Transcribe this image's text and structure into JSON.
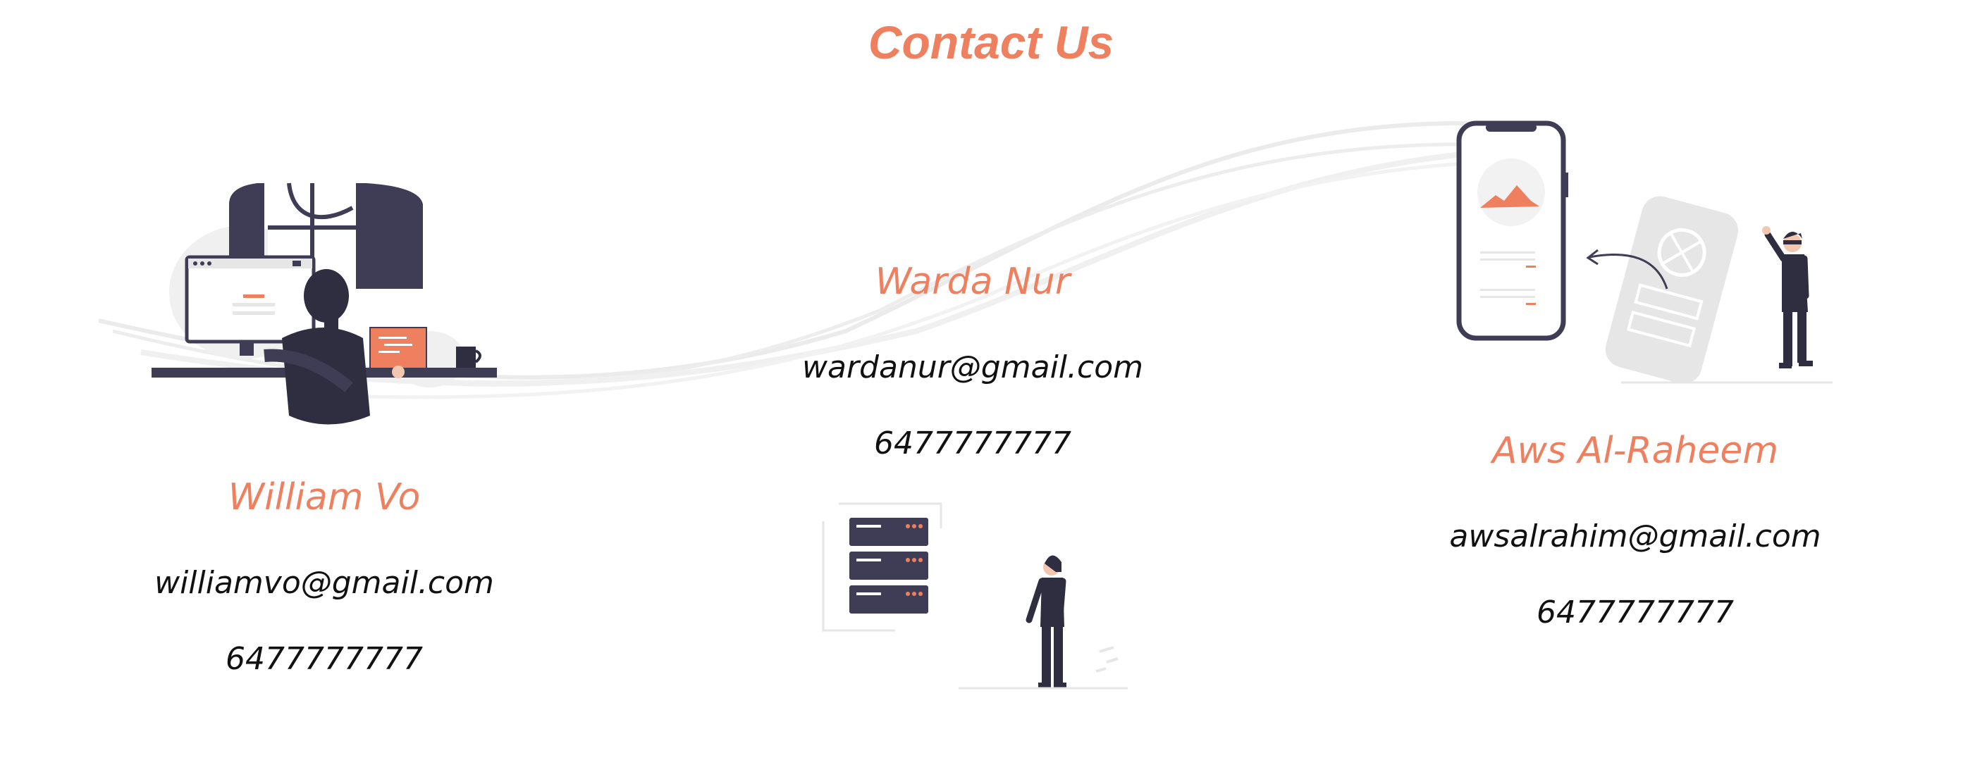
{
  "page": {
    "title": "Contact Us"
  },
  "contacts": [
    {
      "name": "William Vo",
      "email": "williamvo@gmail.com",
      "phone": "6477777777"
    },
    {
      "name": "Warda Nur",
      "email": "wardanur@gmail.com",
      "phone": "6477777777"
    },
    {
      "name": "Aws Al-Raheem",
      "email": "awsalrahim@gmail.com",
      "phone": "6477777777"
    }
  ],
  "colors": {
    "accent": "#ee8060",
    "dark": "#3f3d56",
    "light": "#e6e6e6",
    "text": "#111111"
  },
  "icons": [
    "developer-illustration",
    "server-illustration",
    "mobile-app-illustration"
  ]
}
